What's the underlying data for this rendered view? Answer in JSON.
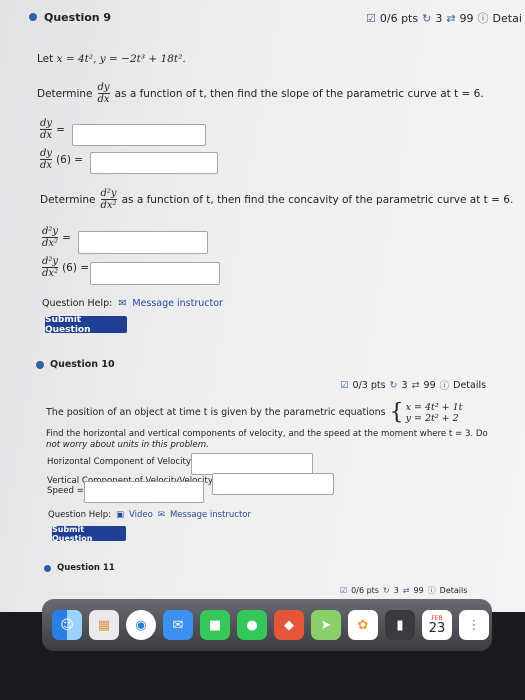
{
  "question9": {
    "title": "Question 9",
    "score": "0/6 pts",
    "attempts": "3",
    "retries": "99",
    "details": "Detai",
    "given_prefix": "Let",
    "given_x": "x = 4t², y = −2t³ + 18t².",
    "determine1": "Determine",
    "determine1_rest": "as a function of t, then find the slope of the parametric curve at t = 6.",
    "dy": "dy",
    "dx": "dx",
    "eq": "=",
    "at6": "(6) =",
    "determine2": "Determine",
    "determine2_rest": "as a function of t, then find the concavity of the parametric curve at t = 6.",
    "d2y": "d²y",
    "dx2": "dx²",
    "help_label": "Question Help:",
    "message_instructor": "Message instructor",
    "submit": "Submit Question"
  },
  "question10": {
    "title": "Question 10",
    "score": "0/3 pts",
    "attempts": "3",
    "retries": "99",
    "details": "Details",
    "line1": "The position of an object at time t is given by the parametric equations",
    "eq_x": "x = 4t² + 1t",
    "eq_y": "y = 2t² + 2",
    "line2": "Find the horizontal and vertical components of velocity, and the speed at the moment where t = 3. Do",
    "line3": "not worry about units in this problem.",
    "horizontal_label": "Horizontal Component of Velocity =",
    "vertical_label": "Vertical Component of VelocityVelocity =",
    "speed_label": "Speed =",
    "help_label": "Question Help:",
    "video": "Video",
    "message_instructor": "Message instructor",
    "submit": "Submit Question"
  },
  "question11": {
    "title": "Question 11",
    "score": "0/6 pts",
    "attempts": "3",
    "retries": "99",
    "details": "Details"
  },
  "dock": {
    "calendar_month": "FEB",
    "calendar_day": "23"
  },
  "colors": {
    "accent": "#1f3f95",
    "dot": "#2d5fa8"
  }
}
